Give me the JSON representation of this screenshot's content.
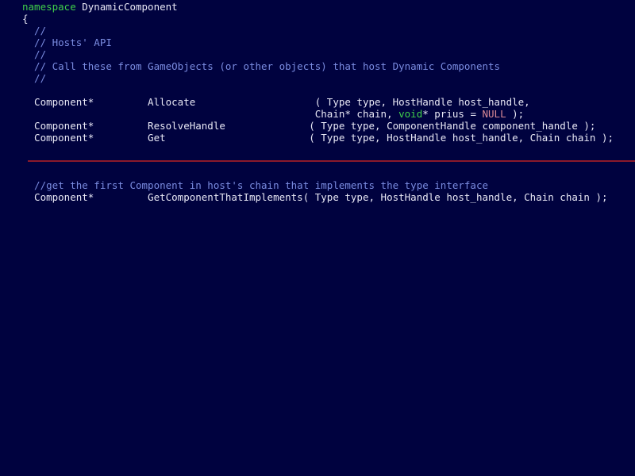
{
  "editor": {
    "background_color": "#00023f",
    "text_color": "#e8e8f5",
    "keyword_color": "#3fd04a",
    "comment_color": "#7a8ce0",
    "constant_color": "#d98a96",
    "separator_color": "#8b1a2b",
    "language": "C++"
  },
  "code": {
    "lines": [
      {
        "id": "line-namespace",
        "tokens": [
          {
            "text": "namespace",
            "type": "keyword"
          },
          {
            "text": " DynamicComponent",
            "type": "plain"
          }
        ]
      },
      {
        "id": "line-open-brace",
        "tokens": [
          {
            "text": "{",
            "type": "punct"
          }
        ]
      },
      {
        "id": "line-comment-1",
        "tokens": [
          {
            "text": "  //",
            "type": "comment"
          }
        ]
      },
      {
        "id": "line-comment-2",
        "tokens": [
          {
            "text": "  // Hosts' API",
            "type": "comment"
          }
        ]
      },
      {
        "id": "line-comment-3",
        "tokens": [
          {
            "text": "  //",
            "type": "comment"
          }
        ]
      },
      {
        "id": "line-comment-4",
        "tokens": [
          {
            "text": "  // Call these from GameObjects (or other objects) that host Dynamic Components",
            "type": "comment"
          }
        ]
      },
      {
        "id": "line-comment-5",
        "tokens": [
          {
            "text": "  //",
            "type": "comment"
          }
        ]
      },
      {
        "id": "line-blank-1",
        "tokens": []
      },
      {
        "id": "line-decl-allocate",
        "tokens": [
          {
            "text": "  Component*         Allocate                    ( Type type, HostHandle host_handle,",
            "type": "plain"
          }
        ]
      },
      {
        "id": "line-decl-allocate-cont",
        "tokens": [
          {
            "text": "                                                 Chain* chain, ",
            "type": "plain"
          },
          {
            "text": "void",
            "type": "keyword"
          },
          {
            "text": "* prius = ",
            "type": "plain"
          },
          {
            "text": "NULL",
            "type": "constant"
          },
          {
            "text": " );",
            "type": "plain"
          }
        ]
      },
      {
        "id": "line-decl-resolvehandle",
        "tokens": [
          {
            "text": "  Component*         ResolveHandle              ( Type type, ComponentHandle component_handle );",
            "type": "plain"
          }
        ]
      },
      {
        "id": "line-decl-get",
        "tokens": [
          {
            "text": "  Component*         Get                        ( Type type, HostHandle host_handle, Chain chain );",
            "type": "plain"
          }
        ]
      },
      {
        "id": "line-blank-2",
        "tokens": []
      },
      {
        "id": "line-separator",
        "tokens": [],
        "separator": true
      },
      {
        "id": "line-blank-3",
        "tokens": []
      },
      {
        "id": "line-comment-6",
        "tokens": [
          {
            "text": "  //get the first Component in host's chain that implements the type interface",
            "type": "comment"
          }
        ]
      },
      {
        "id": "line-decl-getcomponentthatimplements",
        "tokens": [
          {
            "text": "  Component*         GetComponentThatImplements( Type type, HostHandle host_handle, Chain chain );",
            "type": "plain"
          }
        ]
      }
    ]
  }
}
